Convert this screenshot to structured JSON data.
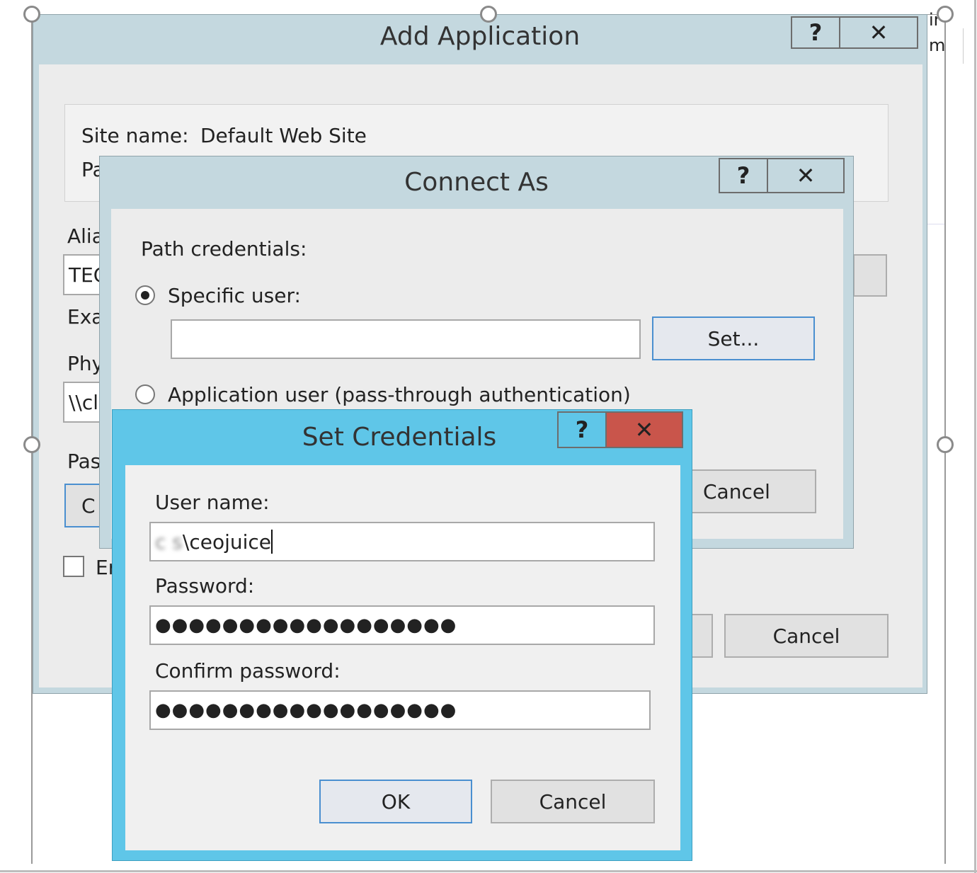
{
  "add_application": {
    "title": "Add Application",
    "help_label": "?",
    "close_label": "✕",
    "site_name_label": "Site name:",
    "site_name_value": "Default Web Site",
    "path_label_partial": "Pa",
    "alias_label_partial": "Alia",
    "alias_value_partial": "TEC",
    "example_label_partial": "Exa",
    "physical_label_partial": "Phy",
    "physical_value_partial": "\\\\cl",
    "pass_label_partial": "Pas",
    "connect_button_partial": "C",
    "enable_label_partial": "Er",
    "cancel_label": "Cancel"
  },
  "background_cut": {
    "line1": "ir",
    "line2": "m"
  },
  "connect_as": {
    "title": "Connect As",
    "help_label": "?",
    "close_label": "✕",
    "path_credentials_label": "Path credentials:",
    "specific_user_label": "Specific user:",
    "specific_user_value": "",
    "set_button_label": "Set...",
    "application_user_label": "Application user (pass-through authentication)",
    "cancel_label": "Cancel"
  },
  "set_credentials": {
    "title": "Set Credentials",
    "help_label": "?",
    "close_label": "✕",
    "user_name_label": "User name:",
    "user_name_prefix": "c s",
    "user_name_value": "\\ceojuice",
    "password_label": "Password:",
    "password_value": "●●●●●●●●●●●●●●●●●●",
    "confirm_password_label": "Confirm password:",
    "confirm_password_value": "●●●●●●●●●●●●●●●●●●",
    "ok_label": "OK",
    "cancel_label": "Cancel"
  },
  "colors": {
    "active_frame": "#5fc6e8",
    "inactive_frame": "#c4d8df",
    "close_red": "#c9554b"
  }
}
